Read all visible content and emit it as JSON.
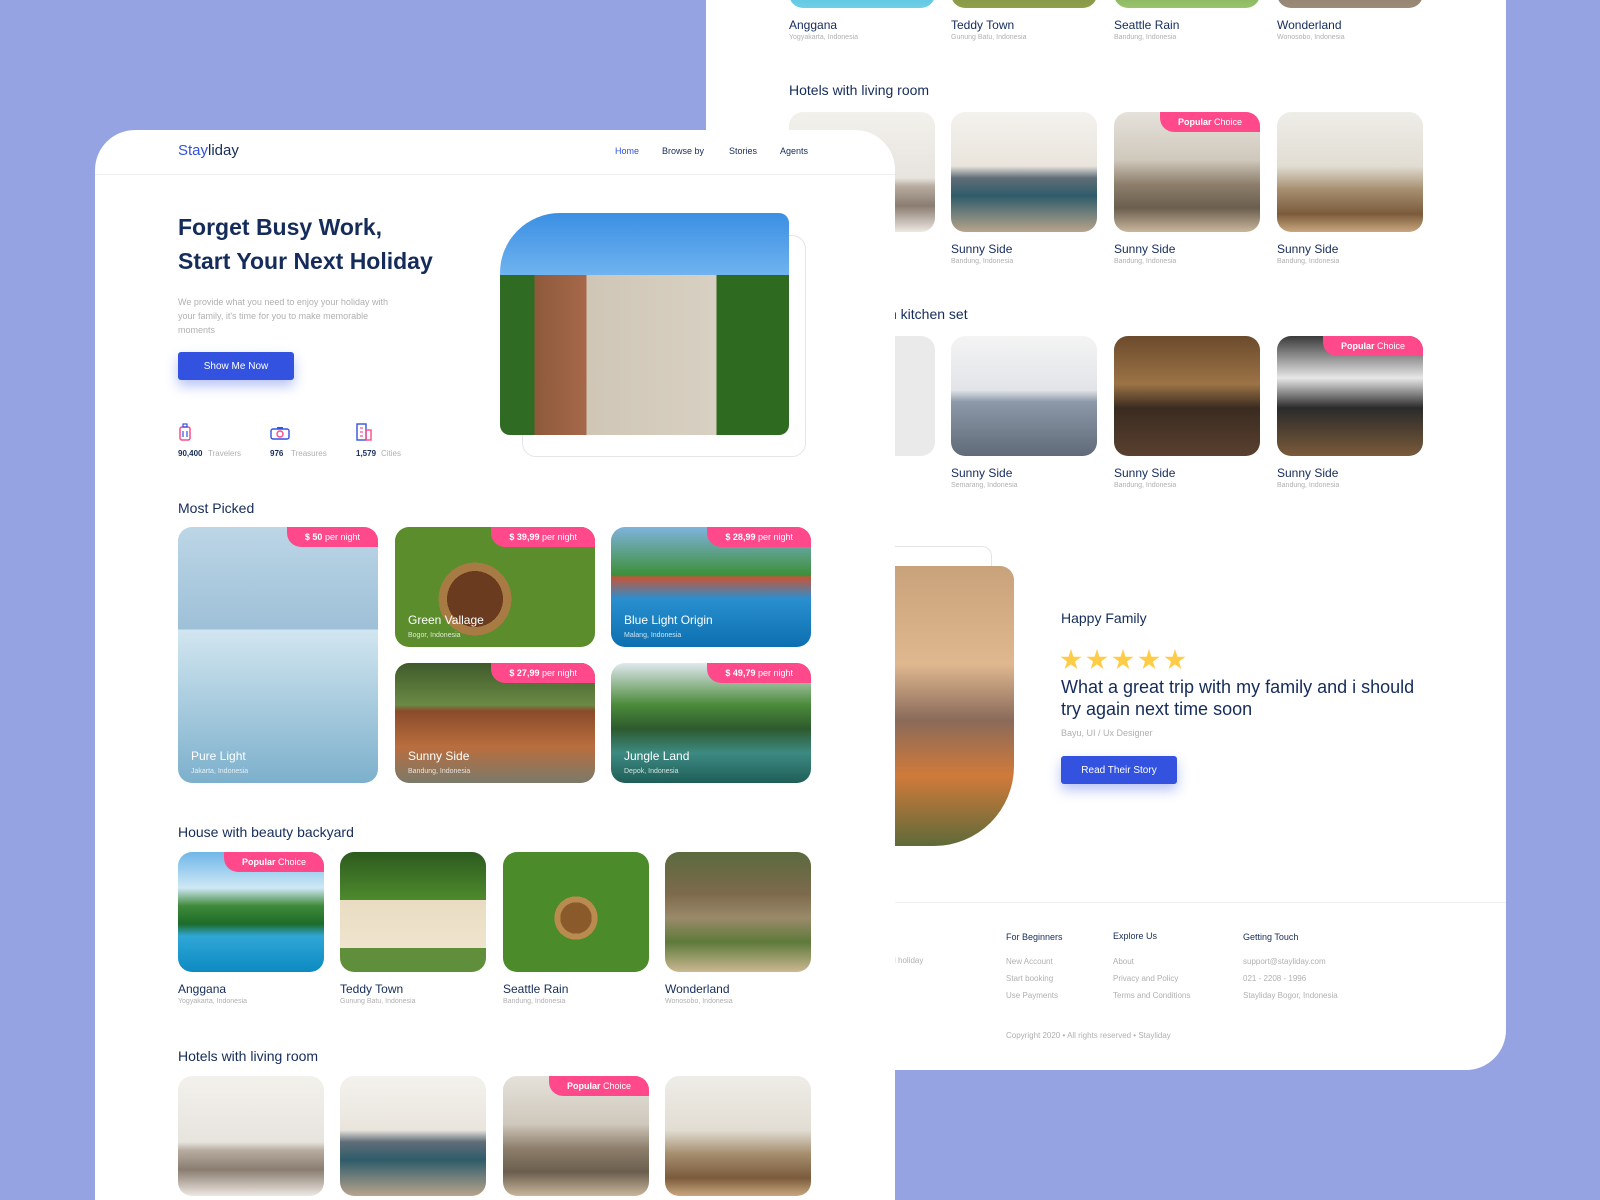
{
  "colors": {
    "background": "#96a3e2",
    "accent": "#3252df",
    "badge": "#ff498b",
    "navy": "#152c5b",
    "star": "#ffcc47"
  },
  "brand": {
    "part1": "Stay",
    "part2": "liday"
  },
  "nav": [
    {
      "label": "Home",
      "active": true
    },
    {
      "label": "Browse by"
    },
    {
      "label": "Stories"
    },
    {
      "label": "Agents"
    }
  ],
  "hero": {
    "title_line1": "Forget Busy Work,",
    "title_line2": "Start Your Next Holiday",
    "description": "We provide what you need to enjoy your holiday with your family, it's time for you to make memorable moments",
    "cta": "Show Me Now",
    "stats": [
      {
        "icon": "suitcase-icon",
        "value": "90,400",
        "label": "Travelers"
      },
      {
        "icon": "camera-icon",
        "value": "976",
        "label": "Treasures"
      },
      {
        "icon": "building-icon",
        "value": "1,579",
        "label": "Cities"
      }
    ]
  },
  "most_picked": {
    "title": "Most Picked",
    "per_night": "per night",
    "items": [
      {
        "name": "Pure Light",
        "location": "Jakarta, Indonesia",
        "price": "$ 50"
      },
      {
        "name": "Green Vallage",
        "location": "Bogor, Indonesia",
        "price": "$ 39,99"
      },
      {
        "name": "Blue Light Origin",
        "location": "Malang, Indonesia",
        "price": "$ 28,99"
      },
      {
        "name": "Sunny Side",
        "location": "Bandung, Indonesia",
        "price": "$ 27,99"
      },
      {
        "name": "Jungle Land",
        "location": "Depok, Indonesia",
        "price": "$ 49,79"
      }
    ]
  },
  "popular": {
    "bold": "Popular",
    "rest": " Choice"
  },
  "backyard": {
    "title": "House with beauty backyard",
    "items": [
      {
        "name": "Anggana",
        "location": "Yogyakarta, Indonesia"
      },
      {
        "name": "Teddy Town",
        "location": "Gunung Batu, Indonesia"
      },
      {
        "name": "Seattle Rain",
        "location": "Bandung, Indonesia"
      },
      {
        "name": "Wonderland",
        "location": "Wonosobo, Indonesia"
      }
    ]
  },
  "living": {
    "title": "Hotels with living room",
    "items": [
      {
        "name": "Sunny Side",
        "location": "Bandung, Indonesia"
      },
      {
        "name": "Sunny Side",
        "location": "Bandung, Indonesia"
      },
      {
        "name": "Sunny Side",
        "location": "Bandung, Indonesia"
      }
    ]
  },
  "kitchen": {
    "title_fragment": "h kitchen set",
    "items": [
      {
        "name": "Sunny Side",
        "location": "Semarang, Indonesia"
      },
      {
        "name": "Sunny Side",
        "location": "Bandung, Indonesia"
      },
      {
        "name": "Sunny Side",
        "location": "Bandung, Indonesia"
      }
    ]
  },
  "testimonial": {
    "title": "Happy Family",
    "rating": 5,
    "quote": "What a great trip with my family and i should try again next time soon",
    "author": "Bayu, UI / Ux Designer",
    "cta": "Read Their Story"
  },
  "footer": {
    "tagline_fragment": "l holiday",
    "columns": [
      {
        "title": "For Beginners",
        "links": [
          "New Account",
          "Start booking",
          "Use Payments"
        ]
      },
      {
        "title": "Explore Us",
        "links": [
          "About",
          "Privacy and Policy",
          "Terms and Conditions"
        ]
      },
      {
        "title": "Getting Touch",
        "links": [
          "support@stayliday.com",
          "021 - 2208 - 1996",
          "Stayliday Bogor,  Indonesia"
        ]
      }
    ],
    "copyright": "Copyright 2020 • All rights reserved • Stayliday"
  }
}
